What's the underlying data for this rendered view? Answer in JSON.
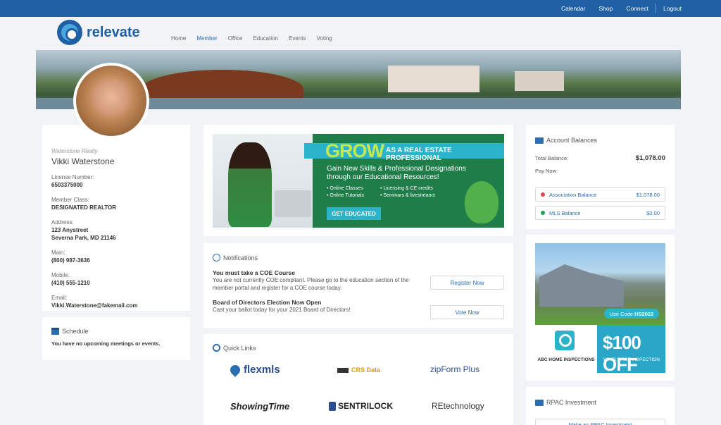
{
  "topnav": {
    "links": [
      "Calendar",
      "Shop",
      "Connect"
    ],
    "logout": "Logout"
  },
  "brand": {
    "name": "relevate"
  },
  "mainnav": [
    "Home",
    "Member",
    "Office",
    "Education",
    "Events",
    "Voting"
  ],
  "profile": {
    "company": "Waterstone Realty",
    "name": "Vikki Waterstone",
    "license_label": "License Number:",
    "license": "6503375000",
    "class_label": "Member Class:",
    "class": "DESIGNATED REALTOR",
    "address_label": "Address:",
    "address1": "123 Anystreet",
    "address2": "Severna Park, MD 21146",
    "main_label": "Main:",
    "main": "(800) 987-3636",
    "mobile_label": "Mobile:",
    "mobile": "(410) 555-1210",
    "email_label": "Email:",
    "email": "Vikki.Waterstone@fakemail.com"
  },
  "schedule": {
    "title": "Schedule",
    "message": "You have no upcoming meetings or events."
  },
  "promo": {
    "headline": "GROW",
    "subheadline": "AS A REAL ESTATE PROFESSIONAL",
    "description": "Gain New Skills & Professional Designations through our Educational Resources!",
    "bullets": [
      "• Online Classes",
      "• Licensing & CE credits",
      "• Online Tutorials",
      "• Seminars & livestreams"
    ],
    "cta": "GET EDUCATED"
  },
  "notifications": {
    "title": "Notifications",
    "items": [
      {
        "title": "You must take a COE Course",
        "body": "You are not currently COE compliant. Please go to the education section of the member portal and register for a COE course today.",
        "button": "Register Now"
      },
      {
        "title": "Board of Directors Election Now Open",
        "body": "Cast your ballot today for your 2021 Board of Directors!",
        "button": "Vote Now"
      }
    ]
  },
  "quick_links": {
    "title": "Quick Links",
    "items": [
      "flexmls",
      "CRS Data",
      "zipForm Plus",
      "ShowingTime",
      "SENTRILOCK",
      "REtechnology"
    ]
  },
  "account": {
    "title": "Account Balances",
    "total_label": "Total Balance:",
    "total": "$1,078.00",
    "pay_now": "Pay Now:",
    "rows": [
      {
        "name": "Association Balance",
        "amount": "$1,078.00",
        "color": "#e0484f"
      },
      {
        "name": "MLS Balance",
        "amount": "$0.00",
        "color": "#1aa45a"
      }
    ]
  },
  "ad": {
    "code_prefix": "Use Code",
    "code": "HS2022",
    "company": "ABC HOME INSPECTIONS",
    "offer": "$100 OFF",
    "offer_sub": "YOUR FIRST INSPECTION"
  },
  "rpac": {
    "title": "RPAC Investment",
    "button": "Make an RPAC Investment"
  }
}
